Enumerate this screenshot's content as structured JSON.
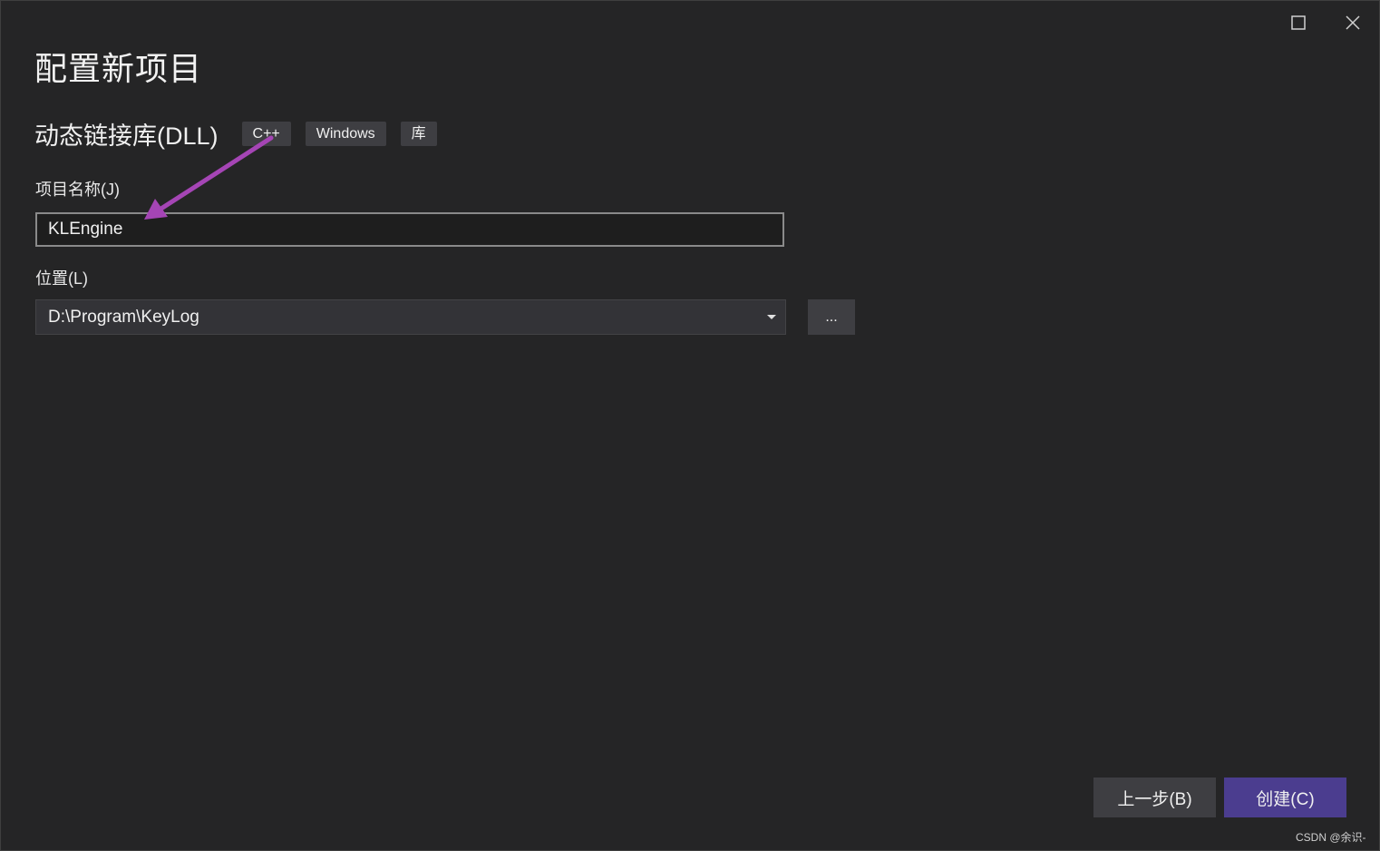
{
  "dialog": {
    "title": "配置新项目"
  },
  "template": {
    "name": "动态链接库(DLL)",
    "tags": [
      "C++",
      "Windows",
      "库"
    ]
  },
  "fields": {
    "project_name_label": "项目名称(J)",
    "project_name_value": "KLEngine",
    "location_label": "位置(L)",
    "location_value": "D:\\Program\\KeyLog",
    "browse_label": "..."
  },
  "footer": {
    "back_label": "上一步(B)",
    "create_label": "创建(C)"
  },
  "watermark": "CSDN @余识-",
  "colors": {
    "background": "#252526",
    "create_button": "#4b3d8f",
    "annotation_arrow": "#a545b5"
  }
}
